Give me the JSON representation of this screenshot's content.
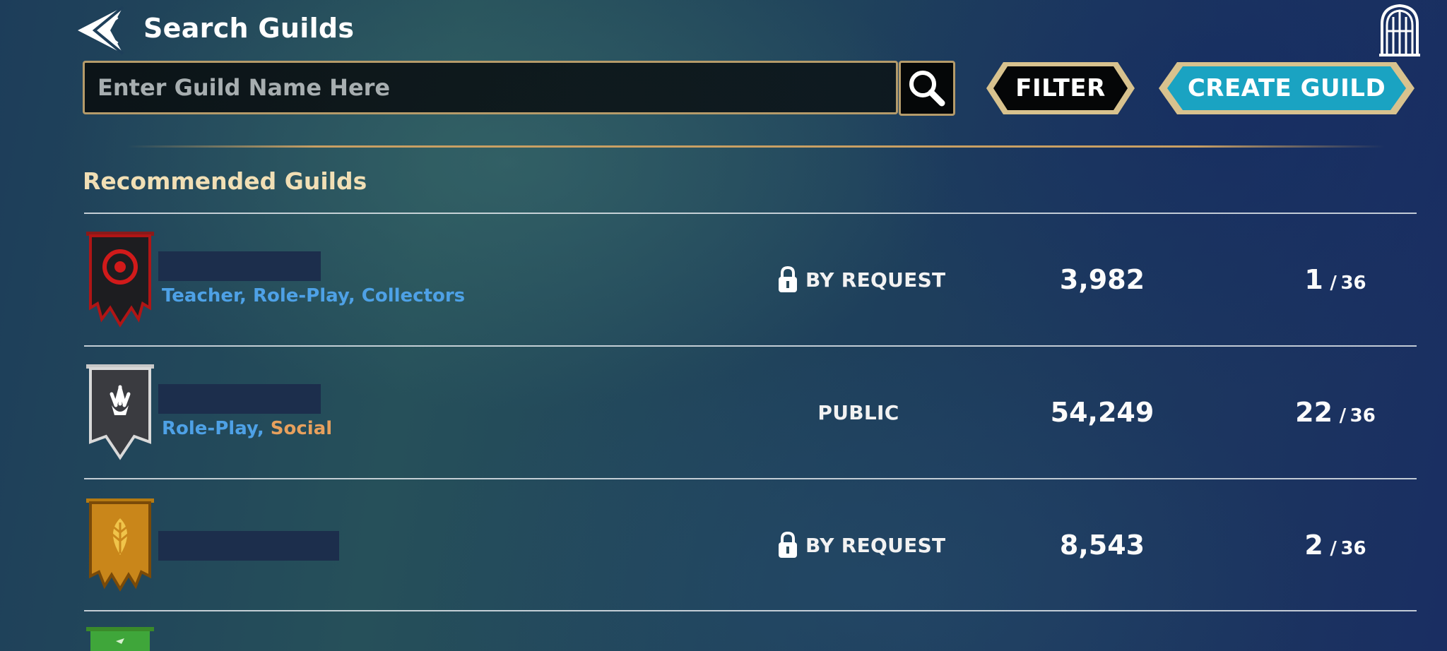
{
  "header": {
    "title": "Search Guilds"
  },
  "search": {
    "placeholder": "Enter Guild Name Here",
    "value": ""
  },
  "buttons": {
    "filter": "FILTER",
    "create_guild": "CREATE GUILD"
  },
  "section": {
    "title": "Recommended Guilds"
  },
  "colors": {
    "accent_gold": "#b59b6a",
    "create_button": "#1aa3c2",
    "tag_blue": "#4ea1e6",
    "tag_orange": "#e7a05d",
    "section_title": "#f1dfb5"
  },
  "guilds": [
    {
      "banner": "red-eye-banner",
      "tags": [
        {
          "text": "Teacher, ",
          "color": "blue"
        },
        {
          "text": "Role-Play, ",
          "color": "blue"
        },
        {
          "text": "Collectors",
          "color": "blue"
        }
      ],
      "access": "BY REQUEST",
      "locked": true,
      "score": "3,982",
      "members_current": "1",
      "members_separator": "/",
      "members_max": "36"
    },
    {
      "banner": "grey-hand-banner",
      "tags": [
        {
          "text": "Role-Play, ",
          "color": "blue"
        },
        {
          "text": "Social",
          "color": "orange"
        }
      ],
      "access": "PUBLIC",
      "locked": false,
      "score": "54,249",
      "members_current": "22",
      "members_separator": "/",
      "members_max": "36"
    },
    {
      "banner": "gold-leaf-banner",
      "tags": [],
      "access": "BY REQUEST",
      "locked": true,
      "score": "8,543",
      "members_current": "2",
      "members_separator": "/",
      "members_max": "36"
    }
  ]
}
